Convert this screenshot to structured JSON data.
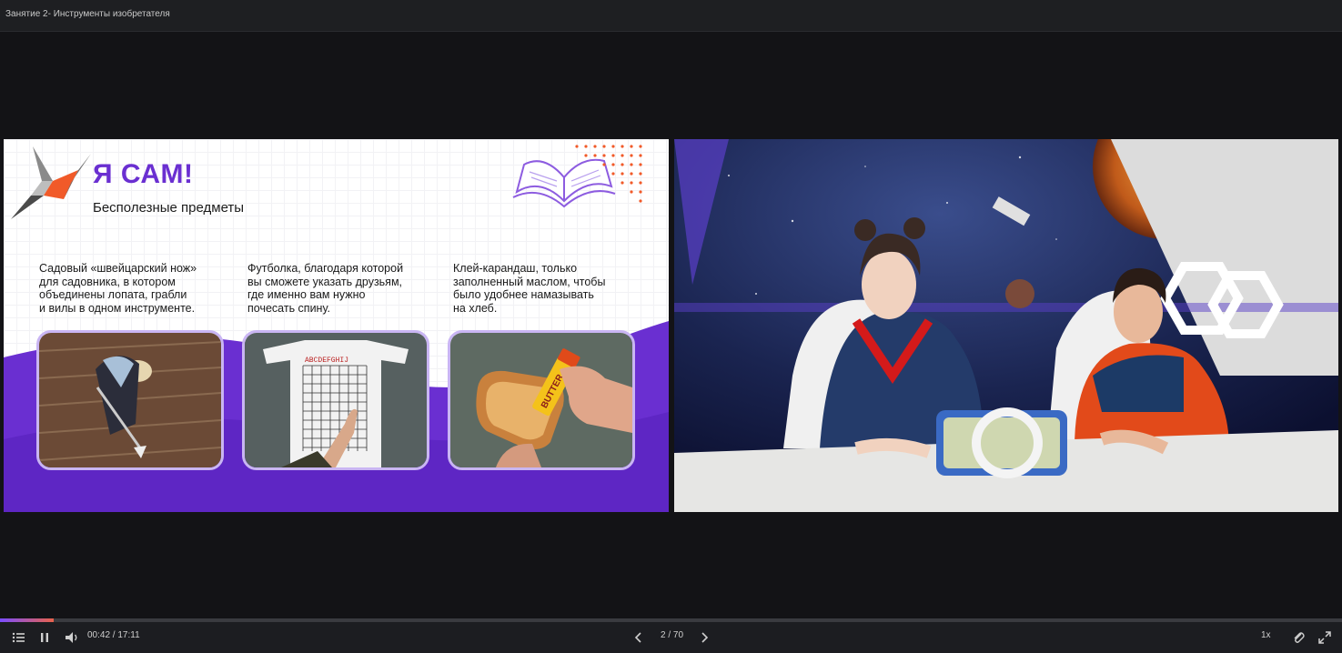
{
  "window": {
    "title": "Занятие 2- Инструменты изобретателя"
  },
  "slide": {
    "heading": "Я САМ!",
    "subheading": "Бесполезные предметы",
    "items": [
      {
        "caption": "Садовый «швейцарский нож»\nдля садовника, в котором\nобъединены лопата, грабли\nи вилы в одном инструменте."
      },
      {
        "caption": "Футболка, благодаря которой\nвы сможете указать друзьям,\nгде именно вам нужно\nпочесать спину.",
        "shirt_letters": "ABCDEFGHIJ",
        "shirt_numbers": "12345678910"
      },
      {
        "caption": "Клей-карандаш, только\nзаполненный маслом, чтобы\nбыло удобнее намазывать\nна хлеб.",
        "stick_label": "BUTTER"
      }
    ],
    "colors": {
      "accent": "#6a2fd1",
      "wave": "#6a2fd1",
      "orange": "#f15a29",
      "frame": "#c9b5f3"
    }
  },
  "player": {
    "progress": 0.04,
    "time": "00:42 / 17:11",
    "page": "2 / 70",
    "speed": "1x",
    "icons": [
      "list-icon",
      "pause-icon",
      "volume-icon",
      "chevron-left-icon",
      "chevron-right-icon",
      "paperclip-icon",
      "fullscreen-icon"
    ]
  }
}
